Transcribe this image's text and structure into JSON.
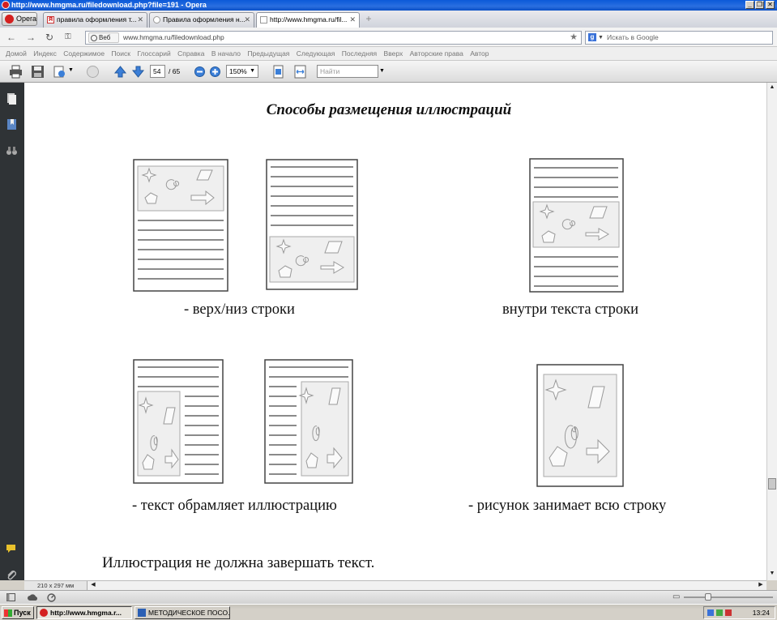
{
  "window": {
    "title": "http://www.hmgma.ru/filedownload.php?file=191 - Opera"
  },
  "menu": {
    "label": "Opera"
  },
  "tabs": [
    {
      "label": "правила оформления т..."
    },
    {
      "label": "Правила оформления н..."
    },
    {
      "label": "http://www.hmgma.ru/fil..."
    }
  ],
  "address": {
    "web_label": "Веб",
    "url": "www.hmgma.ru/filedownload.php"
  },
  "search": {
    "placeholder": "Искать в Google"
  },
  "nav_links": [
    "Домой",
    "Индекс",
    "Содержимое",
    "Поиск",
    "Глоссарий",
    "Справка",
    "В начало",
    "Предыдущая",
    "Следующая",
    "Последняя",
    "Вверх",
    "Авторские права",
    "Автор"
  ],
  "pdf_toolbar": {
    "page_current": "54",
    "page_total": "/ 65",
    "zoom": "150%",
    "find_placeholder": "Найти"
  },
  "document": {
    "title": "Способы размещения иллюстраций",
    "captions": {
      "top_bottom": "- верх/низ строки",
      "inside": "внутри текста строки",
      "wrap": "- текст обрамляет иллюстрацию",
      "full": "- рисунок занимает всю строку"
    },
    "footer_text": "Иллюстрация не должна завершать текст."
  },
  "page_size": "210 x 297 мм",
  "taskbar": {
    "start": "Пуск",
    "items": [
      {
        "label": "http://www.hmgma.r..."
      },
      {
        "label": "МЕТОДИЧЕСКОЕ ПОСО..."
      }
    ],
    "clock": "13:24"
  }
}
